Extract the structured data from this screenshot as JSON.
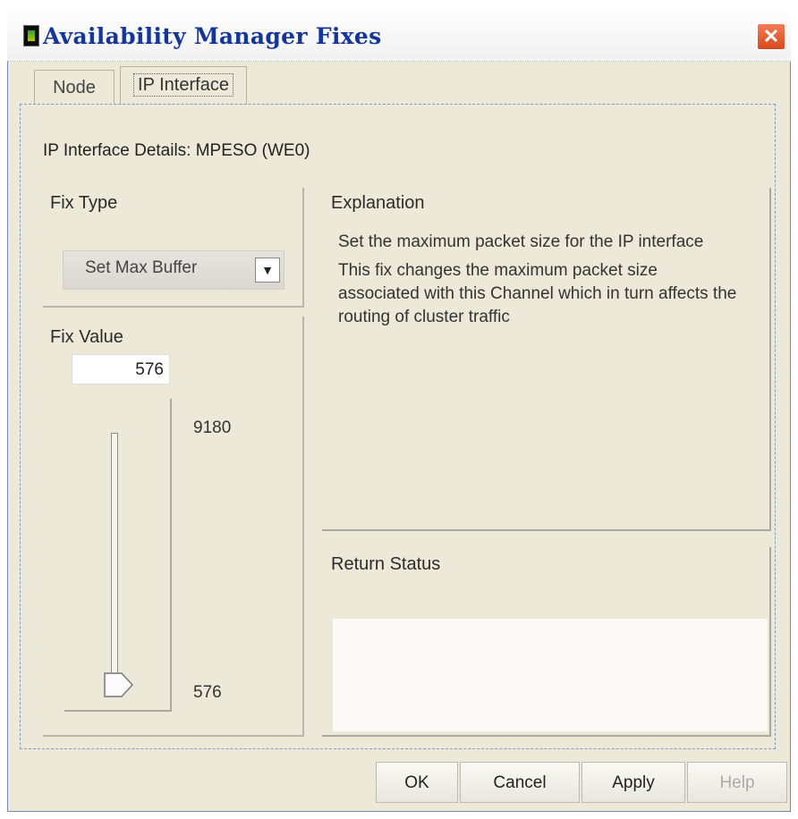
{
  "window": {
    "title": "Availability Manager Fixes",
    "close_label": "✕"
  },
  "tabs": [
    {
      "label": "Node"
    },
    {
      "label": "IP Interface"
    }
  ],
  "details": {
    "text": "IP Interface Details: MPESO  (WE0)"
  },
  "fix_type": {
    "title": "Fix Type",
    "selected": "Set Max Buffer"
  },
  "fix_value": {
    "title": "Fix Value",
    "value": "576",
    "max": "9180",
    "min": "576"
  },
  "explanation": {
    "title": "Explanation",
    "summary": "Set the maximum packet size for the IP interface",
    "detail": "This fix changes the maximum packet size associated with this Channel which in turn affects the routing of cluster traffic"
  },
  "return_status": {
    "title": "Return Status",
    "text": ""
  },
  "buttons": {
    "ok": "OK",
    "cancel": "Cancel",
    "apply": "Apply",
    "help": "Help"
  }
}
